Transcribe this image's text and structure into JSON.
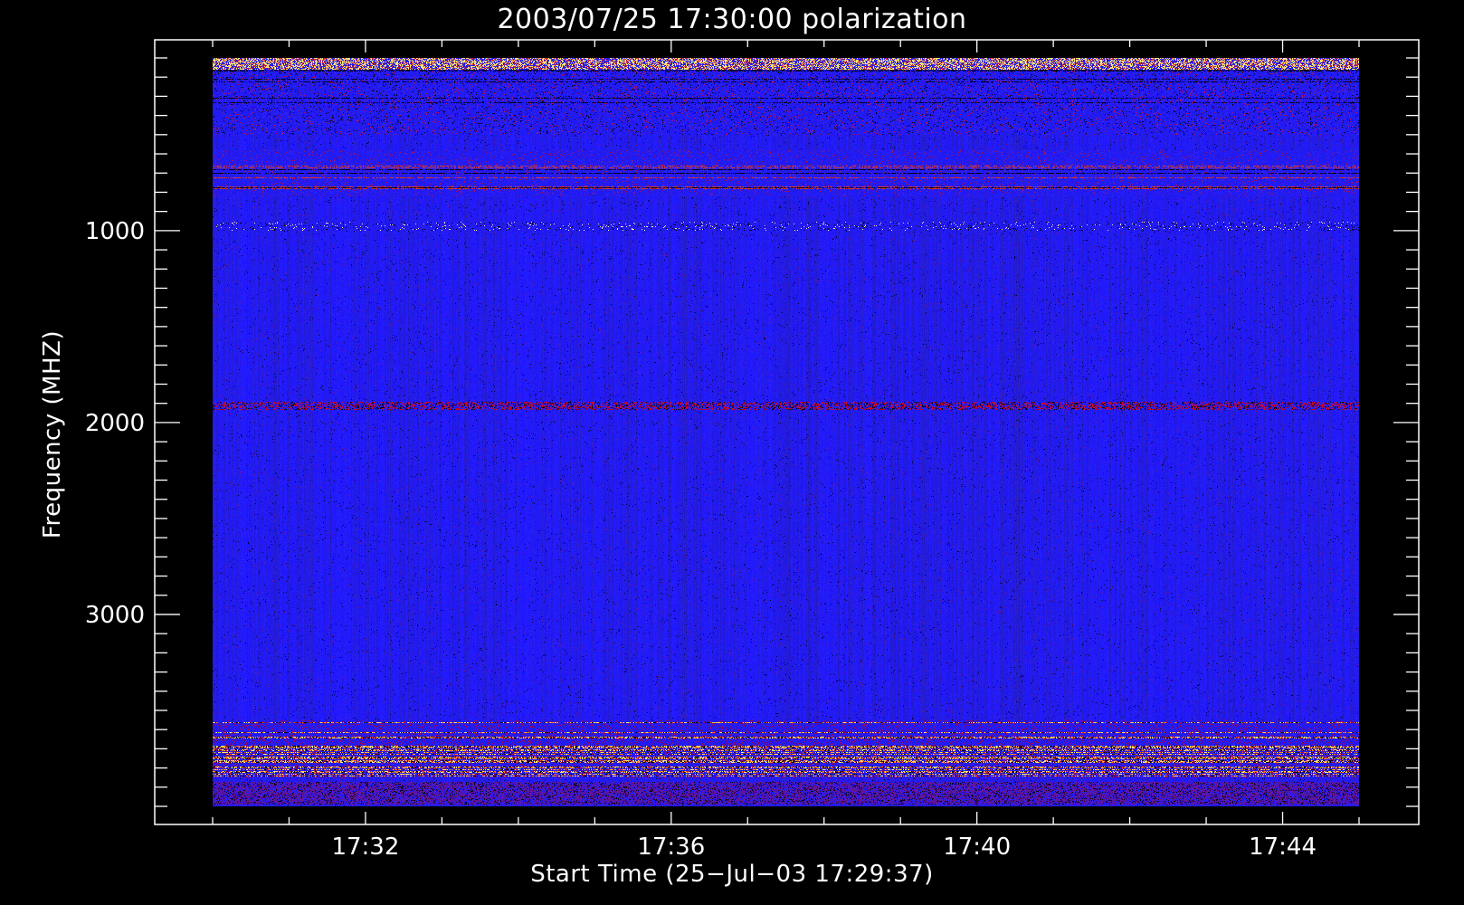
{
  "chart_data": {
    "type": "heatmap",
    "title": "2003/07/25 17:30:00 polarization",
    "xlabel": "Start Time (25−Jul−03 17:29:37)",
    "ylabel": "Frequency (MHZ)",
    "x_tick_labels": [
      "17:32",
      "17:36",
      "17:40",
      "17:44"
    ],
    "y_tick_labels": [
      "1000",
      "2000",
      "3000"
    ],
    "x_range_minutes": [
      0,
      15
    ],
    "x_tick_minutes": [
      2,
      6,
      10,
      14
    ],
    "y_range_mhz": [
      100,
      4000
    ],
    "y_axis_inverted": true,
    "y_tick_values": [
      1000,
      2000,
      3000
    ],
    "colormap": [
      "#000000",
      "#0000ff",
      "#ff0000",
      "#ffff66",
      "#ffffff"
    ],
    "background_level": "blue",
    "features": [
      {
        "freq_mhz": [
          160,
          500
        ],
        "description": "noisy interference band with speckles"
      },
      {
        "freq_mhz": [
          580,
          820
        ],
        "description": "horizontal streak lines"
      },
      {
        "freq_mhz": [
          950,
          1000
        ],
        "description": "intermittent bright flickers"
      },
      {
        "freq_mhz": [
          1890,
          1930
        ],
        "description": "narrow band with red/black segments"
      },
      {
        "freq_mhz": [
          3550,
          3850
        ],
        "description": "strong interference stripes (yellow/orange)"
      },
      {
        "freq_mhz": [
          3870,
          3990
        ],
        "description": "purple striped band"
      }
    ]
  },
  "colors": {
    "background": "#000000",
    "axis": "#ffffff",
    "data_base": "#1a14ee"
  }
}
